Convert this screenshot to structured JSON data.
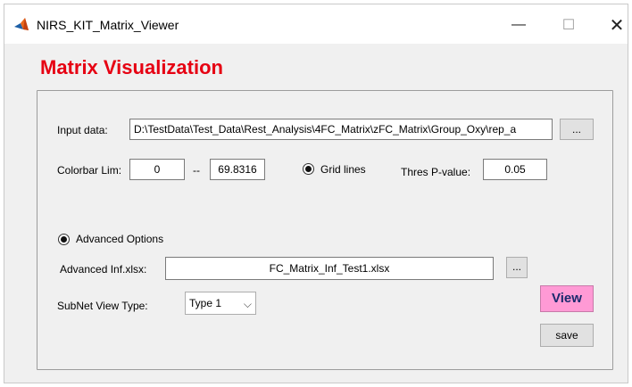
{
  "window": {
    "title": "NIRS_KIT_Matrix_Viewer",
    "controls": {
      "minimize": "—",
      "maximize": "☐",
      "close": "✕"
    },
    "icon": "matlab-icon"
  },
  "heading": "Matrix Visualization",
  "colors": {
    "heading": "#e60012",
    "view_button_bg": "#ff9ad5",
    "view_button_text": "#1a2a6c"
  },
  "input": {
    "label": "Input data:",
    "value": "D:\\TestData\\Test_Data\\Rest_Analysis\\4FC_Matrix\\zFC_Matrix\\Group_Oxy\\rep_a",
    "browse_label": "..."
  },
  "colorbar": {
    "label": "Colorbar Lim:",
    "min": "0",
    "separator": "--",
    "max": "69.8316"
  },
  "grid_lines": {
    "label": "Grid lines",
    "selected": true
  },
  "threshold": {
    "label": "Thres P-value:",
    "value": "0.05"
  },
  "advanced": {
    "option_label": "Advanced Options",
    "selected": true,
    "inf_label": "Advanced Inf.xlsx:",
    "inf_value": "FC_Matrix_Inf_Test1.xlsx",
    "browse_label": "..."
  },
  "subnet": {
    "label": "SubNet View Type:",
    "selected": "Type 1"
  },
  "buttons": {
    "view": "View",
    "save": "save"
  }
}
